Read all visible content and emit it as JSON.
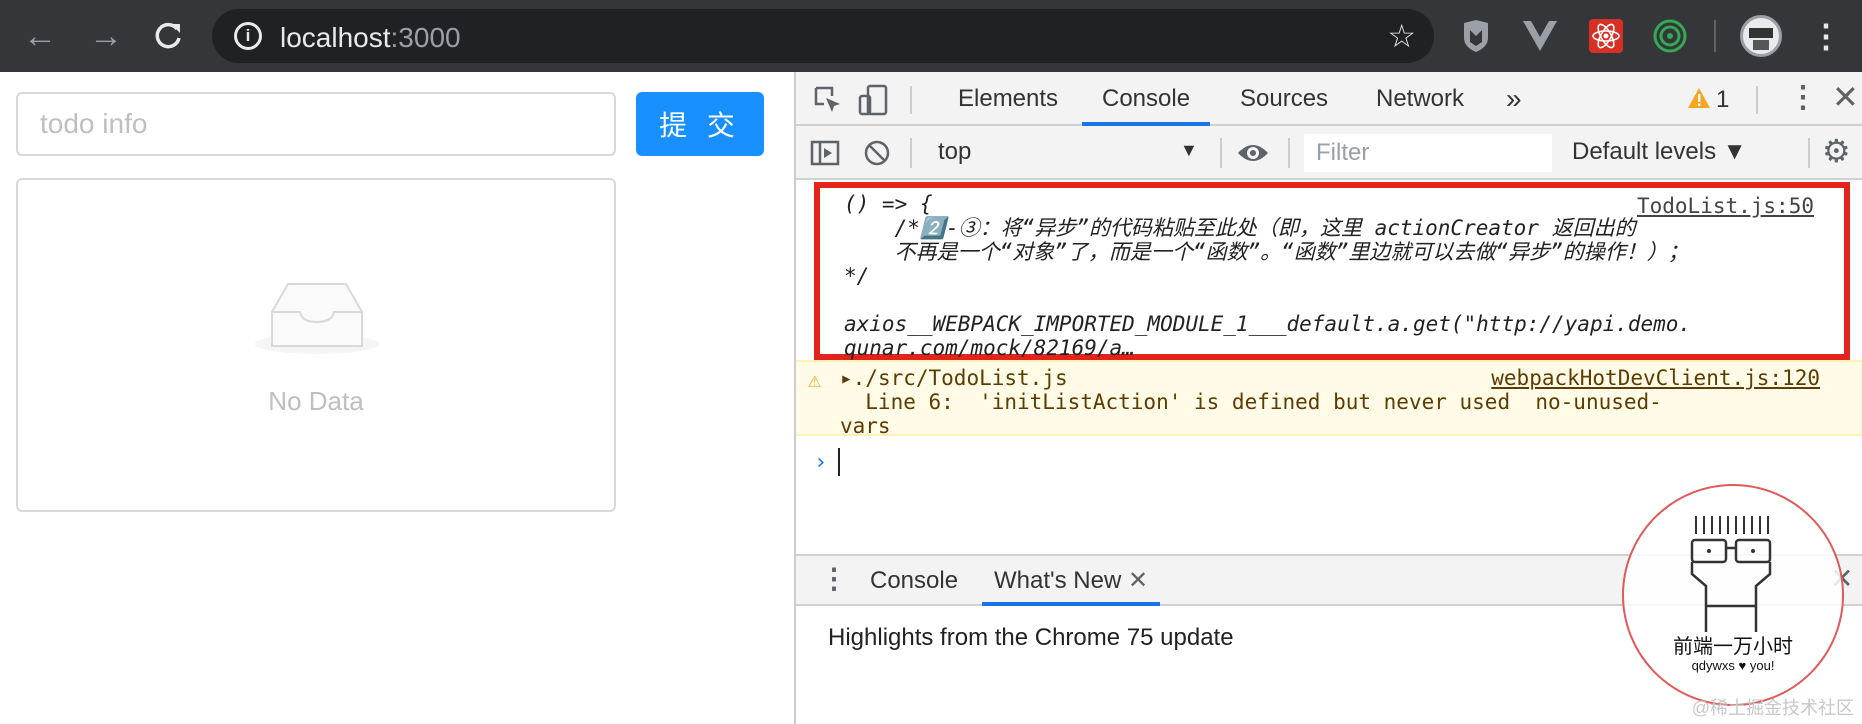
{
  "browser": {
    "url_host": "localhost",
    "url_port": ":3000"
  },
  "page": {
    "todo_placeholder": "todo info",
    "submit_label": "提 交",
    "empty_text": "No Data"
  },
  "devtools": {
    "tabs": [
      "Elements",
      "Console",
      "Sources",
      "Network"
    ],
    "active_tab": "Console",
    "more_tabs": "»",
    "warning_count": "1",
    "context": "top",
    "filter_placeholder": "Filter",
    "levels": "Default levels",
    "log": {
      "lines": [
        "() => {",
        "    /*2️⃣-③：将“异步”的代码粘贴至此处（即，这里 actionCreator 返回出的",
        "    不再是一个“对象”了，而是一个“函数”。“函数”里边就可以去做“异步”的操作！）；",
        "*/",
        "",
        "axios__WEBPACK_IMPORTED_MODULE_1___default.a.get(\"http://yapi.demo.",
        "qunar.com/mock/82169/a…"
      ],
      "source": "TodoList.js:50"
    },
    "warning": {
      "file": "./src/TodoList.js",
      "message_line1": "  Line 6:  'initListAction' is defined but never used  no-unused-",
      "message_line2": "vars",
      "source": "webpackHotDevClient.js:120"
    },
    "drawer": {
      "tabs": [
        "Console",
        "What's New"
      ],
      "active_tab": "What's New",
      "highlights": "Highlights from the Chrome 75 update"
    }
  },
  "watermark": {
    "title": "前端一万小时",
    "subtitle": "qdywxs ♥ you!",
    "footer": "@稀土掘金技术社区"
  },
  "colors": {
    "chrome_bg": "#35363a",
    "primary_button": "#1890ff",
    "highlight_border": "#e3241c",
    "devtools_active": "#1a73e8",
    "warning_bg": "#fffbe6"
  }
}
